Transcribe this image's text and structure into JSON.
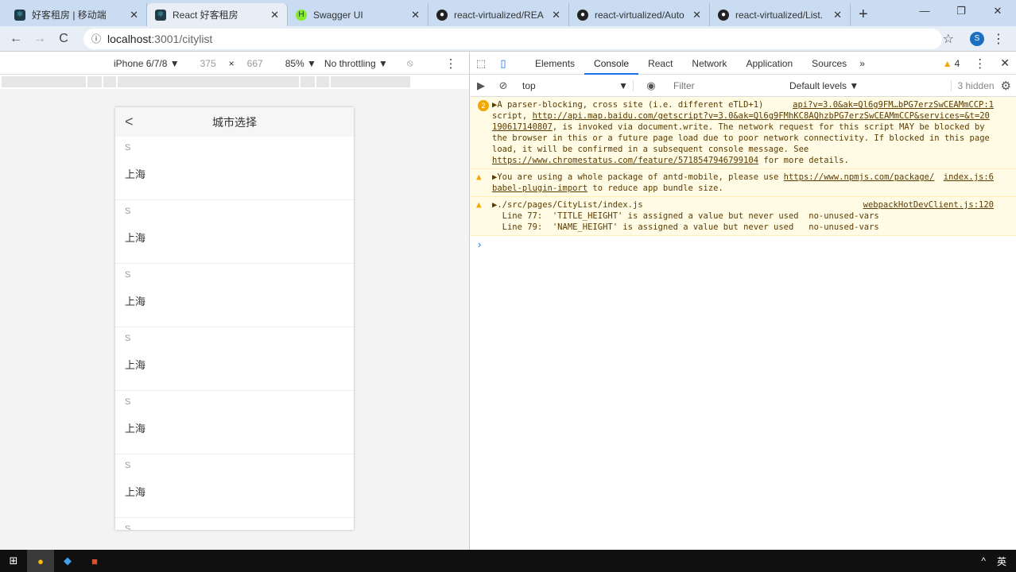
{
  "browser": {
    "tabs": [
      {
        "title": "好客租房 | 移动端",
        "icon": "react-icon"
      },
      {
        "title": "React 好客租房",
        "icon": "react-icon",
        "active": true
      },
      {
        "title": "Swagger UI",
        "icon": "swagger-icon"
      },
      {
        "title": "react-virtualized/REA",
        "icon": "github-icon"
      },
      {
        "title": "react-virtualized/Auto",
        "icon": "github-icon"
      },
      {
        "title": "react-virtualized/List.",
        "icon": "github-icon"
      }
    ],
    "url_host": "localhost",
    "url_path": ":3001/citylist",
    "avatar": "S"
  },
  "device_toolbar": {
    "device": "iPhone 6/7/8 ▼",
    "width": "375",
    "times": "×",
    "height": "667",
    "zoom": "85% ▼",
    "throttling": "No throttling ▼"
  },
  "app": {
    "title": "城市选择",
    "back": "<",
    "groups": [
      {
        "letter": "S",
        "city": "上海"
      },
      {
        "letter": "S",
        "city": "上海"
      },
      {
        "letter": "S",
        "city": "上海"
      },
      {
        "letter": "S",
        "city": "上海"
      },
      {
        "letter": "S",
        "city": "上海"
      },
      {
        "letter": "S",
        "city": "上海"
      },
      {
        "letter": "S",
        "city": ""
      }
    ]
  },
  "devtools": {
    "tabs": [
      "Elements",
      "Console",
      "React",
      "Network",
      "Application",
      "Sources"
    ],
    "active_tab": "Console",
    "more": "»",
    "warning_count": "4",
    "context": "top",
    "filter_placeholder": "Filter",
    "levels": "Default levels ▼",
    "hidden": "3 hidden",
    "messages": [
      {
        "count": "2",
        "source": "api?v=3.0&ak=Ql6g9FM…bPG7erzSwCEAMmCCP:1",
        "pre": "▶A parser-blocking, cross site (i.e. different eTLD+1) script, ",
        "link1": "http://api.map.baidu.com/getscript?v=3.0&ak=Ql6g9FMhKC8AQhzbPG7erzSwCEAMmCCP&services=&t=20190617140807",
        "mid": ", is invoked via document.write. The network request for this script MAY be blocked by the browser in this or a future page load due to poor network connectivity. If blocked in this page load, it will be confirmed in a subsequent console message. See ",
        "link2": "https://www.chromestatus.com/feature/5718547946799104",
        "post": " for more details."
      },
      {
        "source": "index.js:6",
        "pre": "▶You are using a whole package of antd-mobile, please use ",
        "link1": "https://www.npmjs.com/package/babel-plugin-import",
        "post": " to reduce app bundle size."
      },
      {
        "source": "webpackHotDevClient.js:120",
        "pre": "▶./src/pages/CityList/index.js",
        "line1": "  Line 77:  'TITLE_HEIGHT' is assigned a value but never used  no-unused-vars",
        "line2": "  Line 79:  'NAME_HEIGHT' is assigned a value but never used   no-unused-vars"
      }
    ],
    "prompt": "›"
  },
  "colors": {
    "accent": "#1a73e8",
    "warning": "#f2a600",
    "warning_bg": "#fffbe5"
  }
}
